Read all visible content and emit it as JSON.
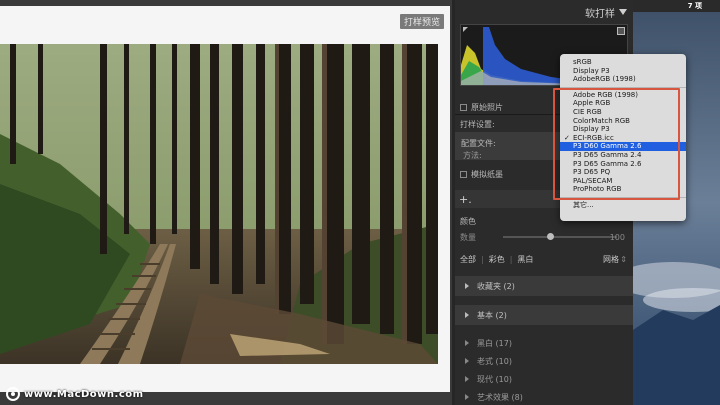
{
  "canvas": {
    "proof_label": "打样预览",
    "watermark": "www.MacDown.com"
  },
  "panel": {
    "header_title": "软打样",
    "show_paper_label": "原始照片",
    "print_settings_label": "打样设置:",
    "profile_label": "配置文件:",
    "method_label": "方法:",
    "simulate_label": "模拟纸墨",
    "color_label": "颜色",
    "amount_label": "数量",
    "amount_value": "100",
    "filters": [
      "全部",
      "彩色",
      "黑白"
    ],
    "grid_label": "网格",
    "sections": [
      {
        "label": "收藏夹 (2)"
      },
      {
        "label": "基本 (2)"
      }
    ],
    "items": [
      {
        "label": "黑白 (17)"
      },
      {
        "label": "老式 (10)"
      },
      {
        "label": "现代 (10)"
      },
      {
        "label": "艺术效果 (8)"
      }
    ]
  },
  "desktop": {
    "count_label": "7 项"
  },
  "menu": {
    "group1": [
      "sRGB",
      "Display P3",
      "AdobeRGB (1998)"
    ],
    "group2": [
      "Adobe RGB (1998)",
      "Apple RGB",
      "CIE RGB",
      "ColorMatch RGB",
      "Display P3",
      "ECI-RGB.icc",
      "P3 D60 Gamma 2.6",
      "P3 D65 Gamma 2.4",
      "P3 D65 Gamma 2.6",
      "P3 D65 PQ",
      "PAL/SECAM",
      "ProPhoto RGB"
    ],
    "checked_item": "ECI-RGB.icc",
    "selected_item": "P3 D60 Gamma 2.6",
    "group3": [
      "其它..."
    ]
  },
  "colors": {
    "menu_bg": "#dcdcdc",
    "selection_blue": "#1f5fe0",
    "highlight_red": "#d8563f",
    "panel_bg": "#2b2b2b"
  }
}
